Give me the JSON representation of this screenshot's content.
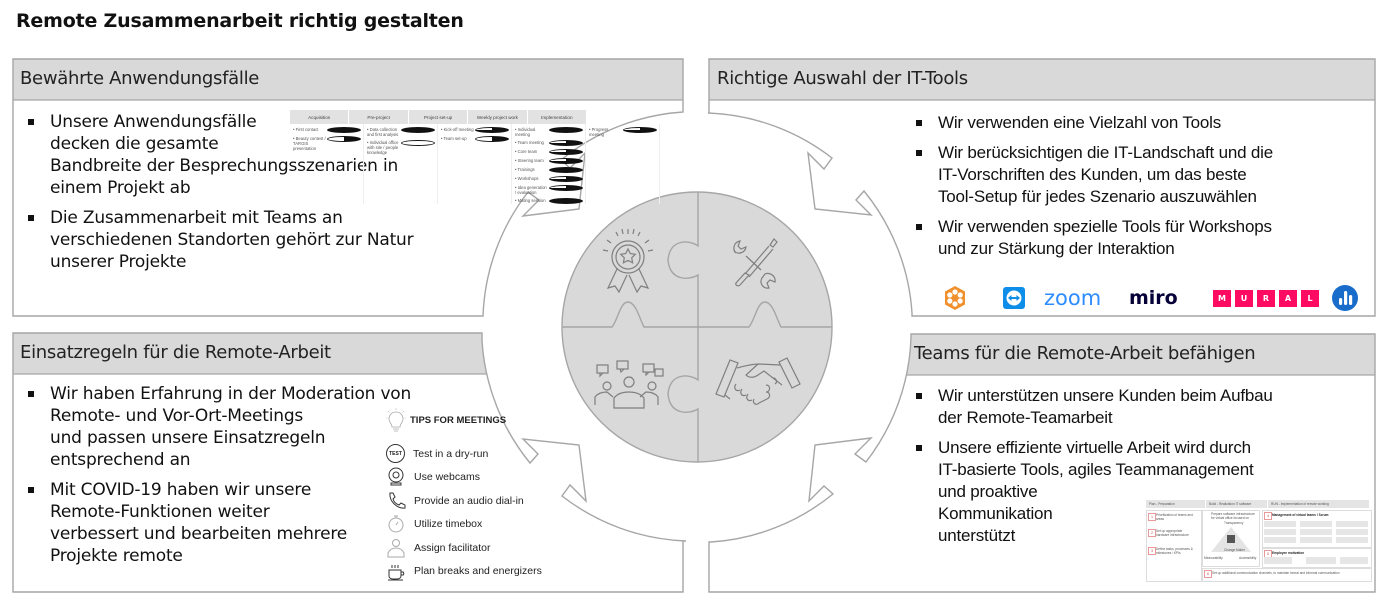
{
  "page": {
    "title": "Remote Zusammenarbeit richtig gestalten"
  },
  "colors": {
    "header_fill": "#d9d9d9",
    "border": "#a6a6a6",
    "circle_fill": "#d9d9d9",
    "icon_stroke": "#7f7f7f"
  },
  "panels": {
    "top_left": {
      "header": "Bewährte Anwendungsfälle",
      "bullets": [
        {
          "lines": [
            "Unsere Anwendungsfälle",
            "decken die gesamte",
            "Bandbreite der Besprechungsszenarien in",
            "einem Projekt ab"
          ]
        },
        {
          "lines": [
            "Die Zusammenarbeit mit Teams an",
            "verschiedenen Standorten gehört zur Natur",
            "unserer Projekte"
          ]
        }
      ],
      "process_table": {
        "phases": [
          "Acquisition",
          "Pre-project",
          "Project set-up",
          "Weekly project work",
          "Implementation"
        ],
        "columns": [
          [
            {
              "label": "First contact",
              "level": 1.0
            },
            {
              "label": "Beauty contest / TARGIS presentation",
              "level": 0.5
            }
          ],
          [
            {
              "label": "Data collection and first analysis",
              "level": 1.0
            },
            {
              "label": "Individual office with site / people knowledge",
              "level": 0.0
            }
          ],
          [
            {
              "label": "Kick-off meeting",
              "level": 0.75
            },
            {
              "label": "Team set-up",
              "level": 0.5
            }
          ],
          [
            {
              "label": "Individual meeting",
              "level": 1.0
            },
            {
              "label": "Team meeting",
              "level": 0.75
            },
            {
              "label": "Core team",
              "level": 0.75
            },
            {
              "label": "Steering team",
              "level": 0.75
            },
            {
              "label": "Trainings",
              "level": 1.0
            },
            {
              "label": "Workshops",
              "level": 0.75
            },
            {
              "label": "Idea generation / evaluation",
              "level": 0.75
            },
            {
              "label": "Mating session",
              "level": 1.0
            }
          ],
          [
            {
              "label": "Progress meeting",
              "level": 0.75
            }
          ]
        ]
      }
    },
    "top_right": {
      "header": "Richtige Auswahl der IT-Tools",
      "bullets": [
        {
          "lines": [
            "Wir verwenden eine Vielzahl von Tools"
          ]
        },
        {
          "lines": [
            "Wir berücksichtigen die IT-Landschaft und die",
            "IT-Vorschriften des Kunden, um das beste",
            "Tool-Setup für jedes Szenario auszuwählen"
          ]
        },
        {
          "lines": [
            "Wir verwenden spezielle Tools für Workshops",
            "und zur Stärkung der Interaktion"
          ]
        }
      ],
      "logos": {
        "flower_icon": "orange-flower-logo",
        "teamviewer_icon": "teamviewer-logo",
        "zoom_text": "zoom",
        "miro_text": "miro",
        "mural_letters": [
          "M",
          "U",
          "R",
          "A",
          "L"
        ],
        "chart_icon": "blue-bars-logo",
        "zoom_color": "#2d8cff",
        "mural_color": "#ff0b61",
        "teamviewer_color": "#0e8ee9",
        "flower_color": "#f0912e",
        "chart_color": "#196cca",
        "miro_color": "#050038"
      }
    },
    "bottom_left": {
      "header": "Einsatzregeln für die Remote-Arbeit",
      "bullets": [
        {
          "lines": [
            "Wir haben Erfahrung in der Moderation von",
            "Remote- und Vor-Ort-Meetings",
            "und passen unsere Einsatzregeln",
            "entsprechend an"
          ]
        },
        {
          "lines": [
            "Mit COVID-19 haben wir unsere",
            "Remote-Funktionen weiter",
            "verbessert und bearbeiten mehrere",
            "Projekte remote"
          ]
        }
      ],
      "tips": {
        "title": "TIPS FOR MEETINGS",
        "test_badge": "TEST",
        "items": [
          "Test in a dry-run",
          "Use webcams",
          "Provide an audio dial-in",
          "Utilize timebox",
          "Assign facilitator",
          "Plan breaks and energizers"
        ]
      }
    },
    "bottom_right": {
      "header": "Teams für die Remote-Arbeit befähigen",
      "bullets": [
        {
          "lines": [
            "Wir unterstützen unsere Kunden beim Aufbau",
            "der Remote-Teamarbeit"
          ]
        },
        {
          "lines": [
            "Unsere effiziente virtuelle Arbeit wird durch",
            "IT-basierte Tools, agiles Teammanagement",
            "und proaktive",
            "Kommunikation",
            "unterstützt"
          ]
        }
      ],
      "plan_image": {
        "phases": [
          "Plan - Preparation",
          "Build - Realization IT software",
          "RUN - Implementation of remote working"
        ],
        "left_steps": [
          "Prioritization of teams and areas",
          "Set up appropriate hardware infrastructure",
          "Define tasks, processes & milestones / KPIs"
        ],
        "build_title": "Prepare software infrastructure for virtual office focused on",
        "triangle_labels": [
          "Transparency",
          "Measurability",
          "Accessibility",
          "Change Maker"
        ],
        "mgmt_title": "Management of virtual teams / Scrum",
        "motivation_title": "Employee motivation",
        "communication_title": "Set up additional communication channels, to maintain formal and informal communication"
      }
    }
  },
  "center": {
    "pieces": [
      "medal-icon",
      "tools-icon",
      "team-discussion-icon",
      "handshake-icon"
    ]
  }
}
